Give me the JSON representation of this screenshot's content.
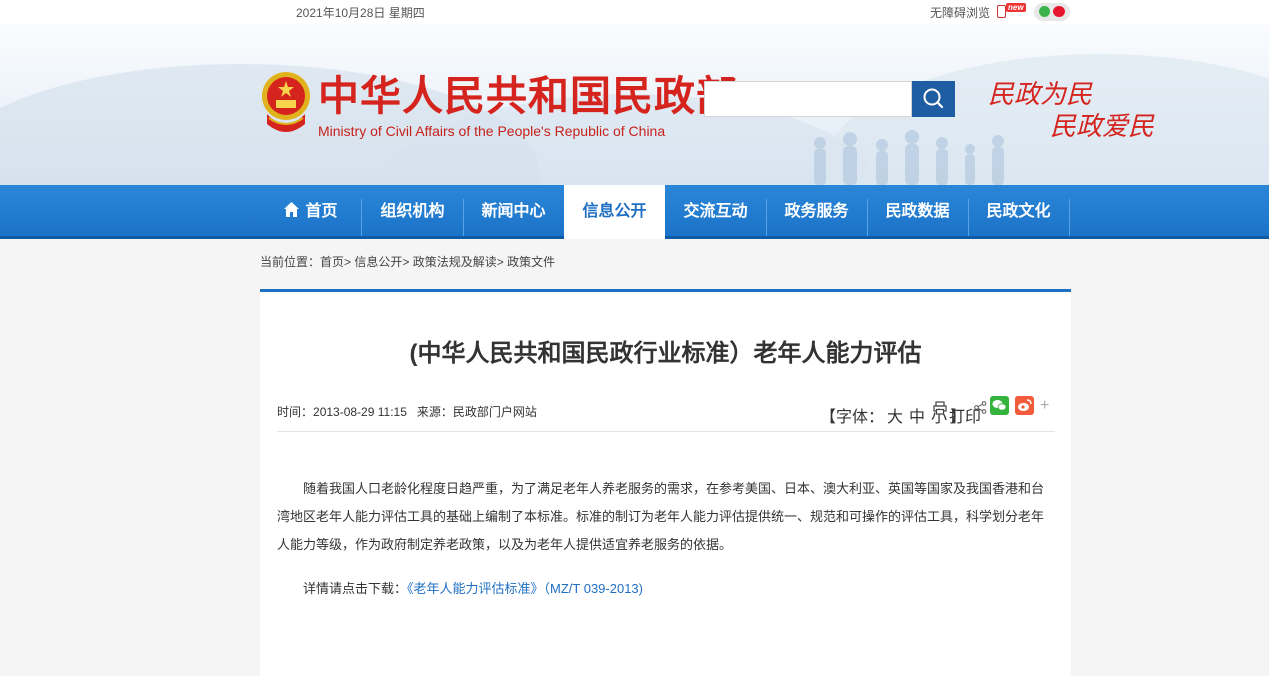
{
  "topbar": {
    "date": "2021年10月28日 星期四",
    "accessibility": "无障碍浏览",
    "new_badge": "new",
    "icons": [
      "mobile-icon",
      "wechat-icon",
      "weibo-icon"
    ]
  },
  "header": {
    "title": "中华人民共和国民政部",
    "subtitle": "Ministry of Civil Affairs of the People's Republic of China",
    "search_placeholder": "",
    "slogan_line1": "民政为民",
    "slogan_line2": "民政爱民"
  },
  "nav": {
    "items": [
      {
        "label": "首页"
      },
      {
        "label": "组织机构"
      },
      {
        "label": "新闻中心"
      },
      {
        "label": "信息公开",
        "active": true
      },
      {
        "label": "交流互动"
      },
      {
        "label": "政务服务"
      },
      {
        "label": "民政数据"
      },
      {
        "label": "民政文化"
      }
    ]
  },
  "breadcrumb": {
    "prefix": "当前位置：",
    "items": [
      "首页",
      "信息公开",
      "政策法规及解读",
      "政策文件"
    ],
    "separator": ">"
  },
  "article": {
    "title": "(中华人民共和国民政行业标准）老年人能力评估",
    "time_label": "时间：",
    "time": "2013-08-29 11:15",
    "source_label": "来源：",
    "source": "民政部门户网站",
    "font_label_open": "【字体：",
    "font_large": "大",
    "font_medium": "中",
    "font_small": "小",
    "font_label_close": "】",
    "print_label": "打印",
    "paragraph1": "随着我国人口老龄化程度日趋严重，为了满足老年人养老服务的需求，在参考美国、日本、澳大利亚、英国等国家及我国香港和台湾地区老年人能力评估工具的基础上编制了本标准。标准的制订为老年人能力评估提供统一、规范和可操作的评估工具，科学划分老年人能力等级，作为政府制定养老政策，以及为老年人提供适宜养老服务的依据。",
    "download_prefix": "详情请点击下载：",
    "download_link": "《老年人能力评估标准》（MZ/T 039-2013)"
  },
  "colors": {
    "brand_red": "#d5231d",
    "nav_blue": "#1a72c6",
    "link_blue": "#1f6fc2"
  }
}
